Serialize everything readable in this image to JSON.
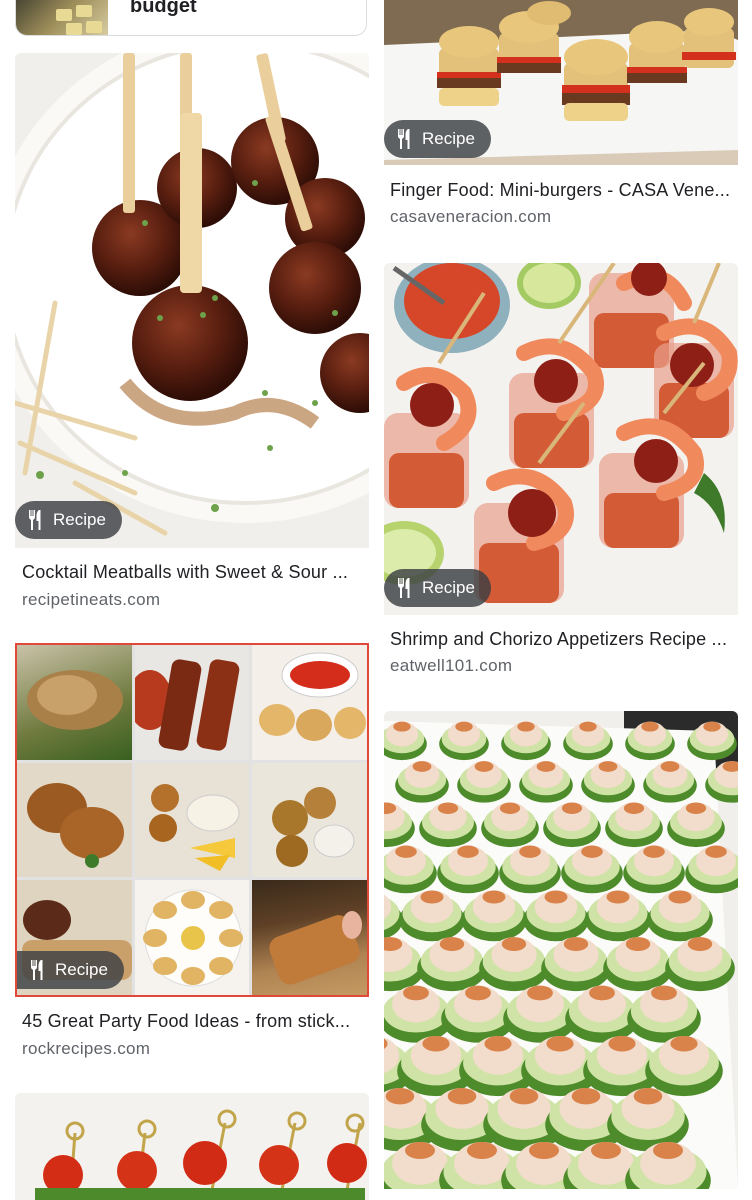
{
  "top_card": {
    "label": "budget"
  },
  "results": [
    {
      "badge": "Recipe",
      "title": "Cocktail Meatballs with Sweet & Sour ...",
      "source": "recipetineats.com"
    },
    {
      "badge": "Recipe",
      "title": "45 Great Party Food Ideas - from stick...",
      "source": "rockrecipes.com"
    },
    {
      "badge": "Recipe",
      "title": "Finger Food: Mini-burgers - CASA Vene...",
      "source": "casaveneracion.com"
    },
    {
      "badge": "Recipe",
      "title": "Shrimp and Chorizo Appetizers Recipe ...",
      "source": "eatwell101.com"
    }
  ],
  "icons": {
    "badge_icon": "fork-knife-icon"
  },
  "colors": {
    "badge_bg": "#3c4043",
    "title": "#202124",
    "source": "#5f6368",
    "card_border": "#dadce0",
    "collage_border": "#e0493a"
  }
}
